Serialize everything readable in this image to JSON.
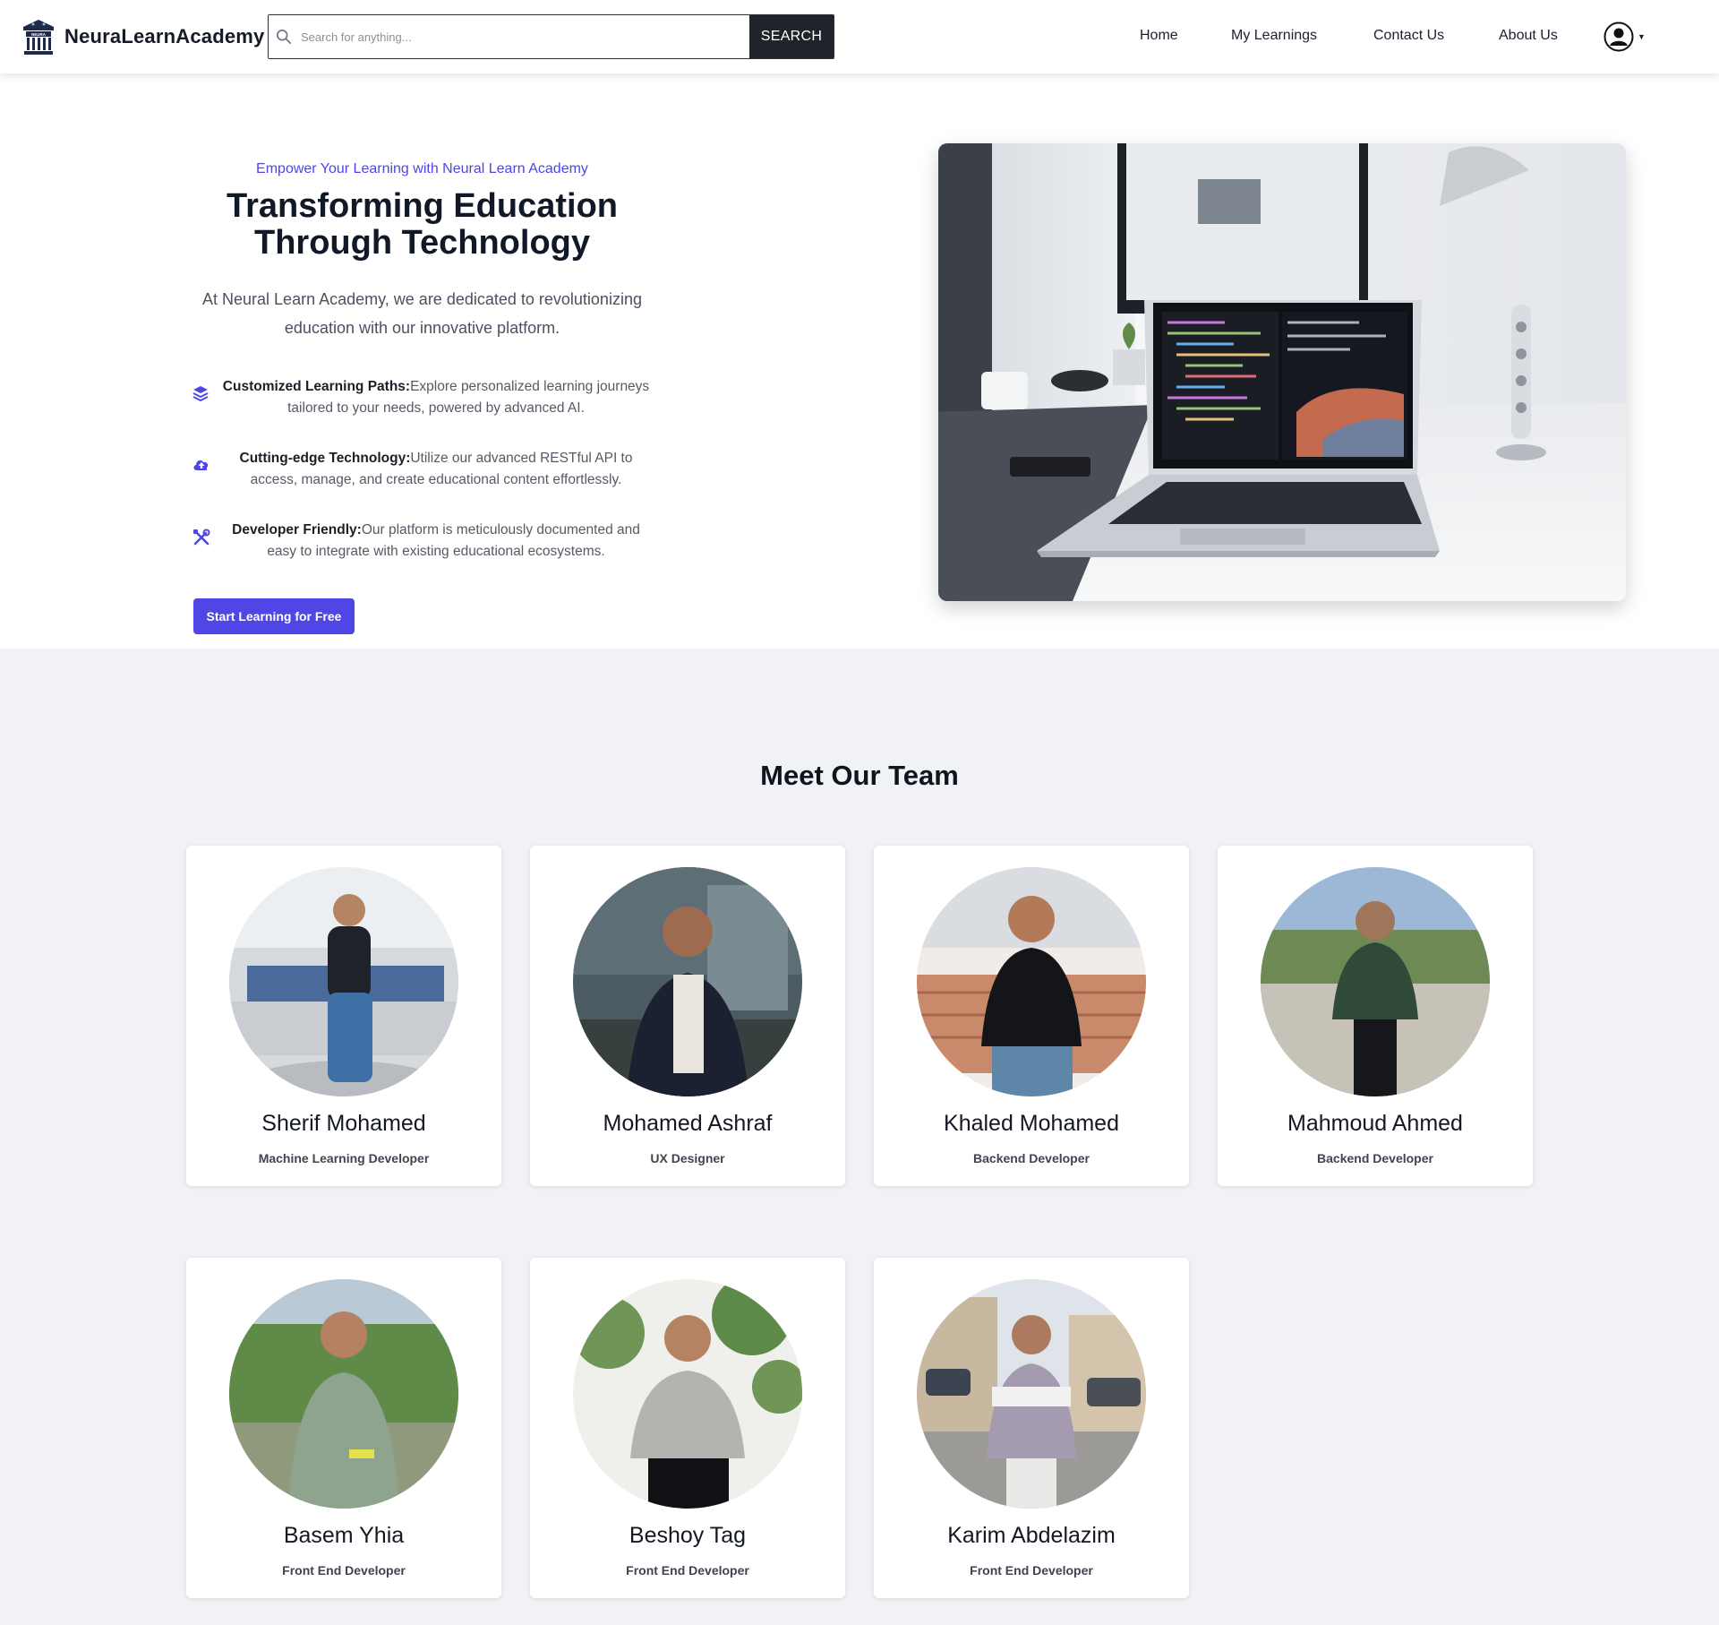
{
  "navbar": {
    "brand_name": "NeuraLearnAcademy",
    "logo_text": "NEURA",
    "search_placeholder": "Search for anything...",
    "search_button": "SEARCH",
    "links": [
      "Home",
      "My Learnings",
      "Contact Us",
      "About Us"
    ],
    "profile_icon": "user-circle-icon"
  },
  "hero": {
    "eyebrow": "Empower Your Learning with Neural Learn Academy",
    "title_line1": "Transforming Education",
    "title_line2": "Through Technology",
    "description": "At Neural Learn Academy, we are dedicated to revolutionizing education with our innovative platform.",
    "features": [
      {
        "icon": "layers-icon",
        "heading": "Customized Learning Paths:",
        "text": "Explore personalized learning journeys tailored to your needs, powered by advanced AI."
      },
      {
        "icon": "cloud-upload-icon",
        "heading": "Cutting-edge Technology:",
        "text": "Utilize our advanced RESTful API to access, manage, and create educational content effortlessly."
      },
      {
        "icon": "tools-icon",
        "heading": "Developer Friendly:",
        "text": "Our platform is meticulously documented and easy to integrate with existing educational ecosystems."
      }
    ],
    "cta_label": "Start Learning for Free"
  },
  "team": {
    "title": "Meet Our Team",
    "members": [
      {
        "name": "Sherif Mohamed",
        "role": "Machine Learning Developer"
      },
      {
        "name": "Mohamed Ashraf",
        "role": "UX Designer"
      },
      {
        "name": "Khaled Mohamed",
        "role": "Backend Developer"
      },
      {
        "name": "Mahmoud Ahmed",
        "role": "Backend Developer"
      },
      {
        "name": "Basem Yhia",
        "role": "Front End Developer"
      },
      {
        "name": "Beshoy Tag",
        "role": "Front End Developer"
      },
      {
        "name": "Karim Abdelazim",
        "role": "Front End Developer"
      }
    ]
  },
  "colors": {
    "accent": "#4f46e5",
    "dark": "#21232b",
    "page_bg": "#f1f2f5"
  }
}
